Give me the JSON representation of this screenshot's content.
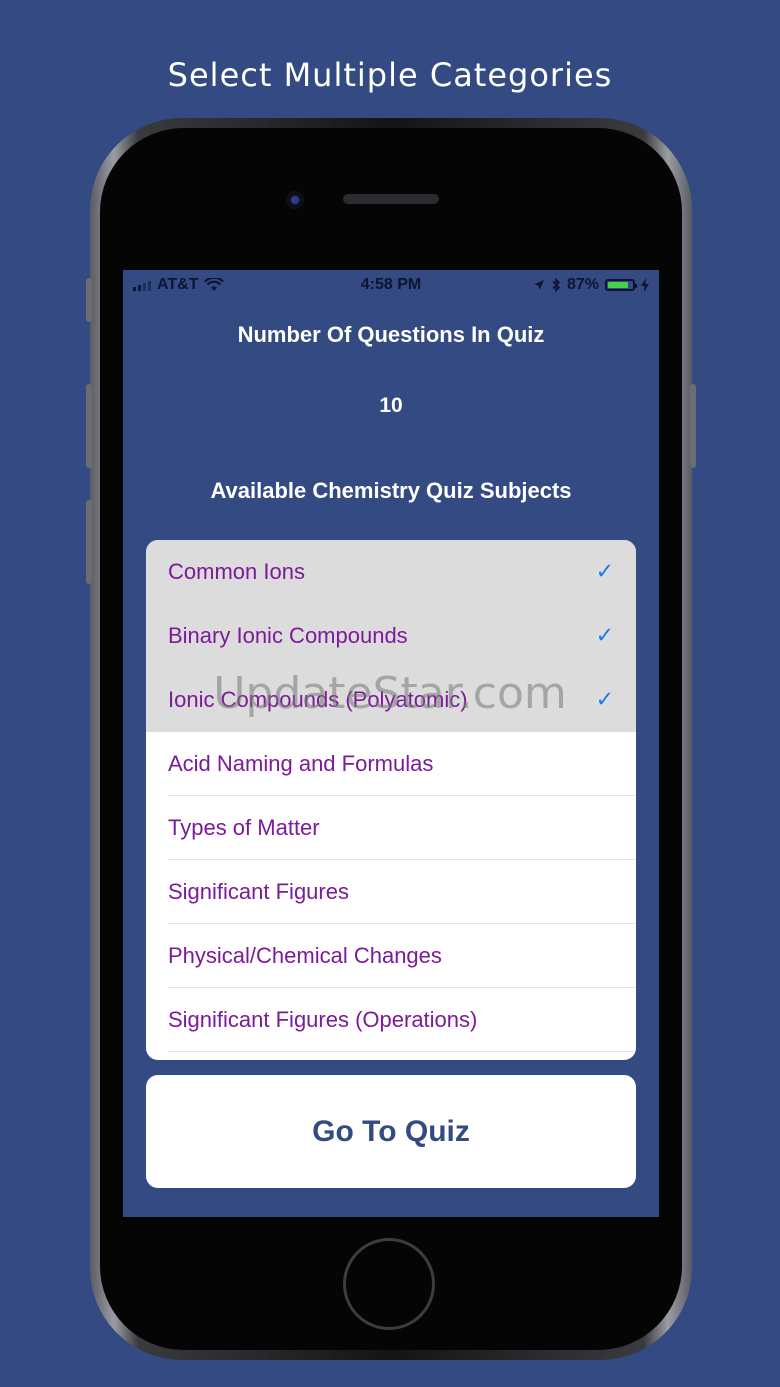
{
  "caption": "Select Multiple Categories",
  "statusbar": {
    "carrier": "AT&T",
    "time": "4:58 PM",
    "battery_percent": "87%",
    "battery_level": 0.87,
    "icons": [
      "signal-icon",
      "wifi-icon",
      "location-icon",
      "bluetooth-icon",
      "battery-icon",
      "charging-icon"
    ]
  },
  "quiz": {
    "questions_heading": "Number Of Questions In Quiz",
    "questions_count": "10",
    "subjects_heading": "Available Chemistry Quiz Subjects"
  },
  "subjects": [
    {
      "label": "Common Ions",
      "selected": true
    },
    {
      "label": "Binary Ionic Compounds",
      "selected": true
    },
    {
      "label": "Ionic Compounds (Polyatomic)",
      "selected": true
    },
    {
      "label": "Acid Naming and Formulas",
      "selected": false
    },
    {
      "label": "Types of Matter",
      "selected": false
    },
    {
      "label": "Significant Figures",
      "selected": false
    },
    {
      "label": "Physical/Chemical Changes",
      "selected": false
    },
    {
      "label": "Significant Figures (Operations)",
      "selected": false
    }
  ],
  "go_button": "Go To Quiz",
  "watermark": "UpdateStar.com",
  "colors": {
    "background": "#334a83",
    "item_text": "#7d1a9b",
    "checkmark": "#1e7cf2",
    "selected_row": "#dcdcdc"
  }
}
